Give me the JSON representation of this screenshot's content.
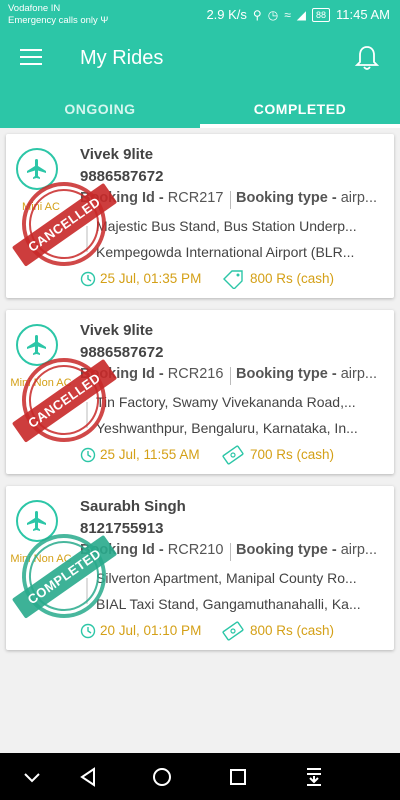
{
  "status_bar": {
    "carrier": "Vodafone IN",
    "emergency": "Emergency calls only",
    "speed": "2.9 K/s",
    "battery": "88",
    "time": "11:45 AM"
  },
  "app_bar": {
    "title": "My Rides"
  },
  "tabs": [
    {
      "label": "ONGOING",
      "selected": false
    },
    {
      "label": "COMPLETED",
      "selected": true
    }
  ],
  "rides": [
    {
      "cab_type": "Mini AC",
      "name": "Vivek 9lite",
      "phone": "9886587672",
      "booking_label": "Booking Id - ",
      "booking_id": "RCR217",
      "booking_type_label": "Booking type - ",
      "booking_type": "airp...",
      "pickup": "Majestic Bus Stand, Bus Station Underp...",
      "drop": "Kempegowda International Airport (BLR...",
      "date": "25 Jul, 01:35 PM",
      "fare": "800 Rs (cash)",
      "status": "CANCELLED"
    },
    {
      "cab_type": "Mini Non AC",
      "name": "Vivek 9lite",
      "phone": "9886587672",
      "booking_label": "Booking Id - ",
      "booking_id": "RCR216",
      "booking_type_label": "Booking type - ",
      "booking_type": "airp...",
      "pickup": "Tin Factory, Swamy Vivekananda Road,...",
      "drop": "Yeshwanthpur, Bengaluru, Karnataka, In...",
      "date": "25 Jul, 11:55 AM",
      "fare": "700 Rs (cash)",
      "status": "CANCELLED"
    },
    {
      "cab_type": "Mini Non AC",
      "name": "Saurabh Singh",
      "phone": "8121755913",
      "booking_label": "Booking Id - ",
      "booking_id": "RCR210",
      "booking_type_label": "Booking type - ",
      "booking_type": "airp...",
      "pickup": "Silverton Apartment, Manipal County Ro...",
      "drop": "BIAL Taxi Stand, Gangamuthanahalli, Ka...",
      "date": "20 Jul, 01:10 PM",
      "fare": "800 Rs (cash)",
      "status": "COMPLETED"
    }
  ],
  "colors": {
    "accent": "#2cc6a7",
    "gold": "#d4a017",
    "cancelled": "#c82828",
    "completed": "#28aa8c"
  }
}
